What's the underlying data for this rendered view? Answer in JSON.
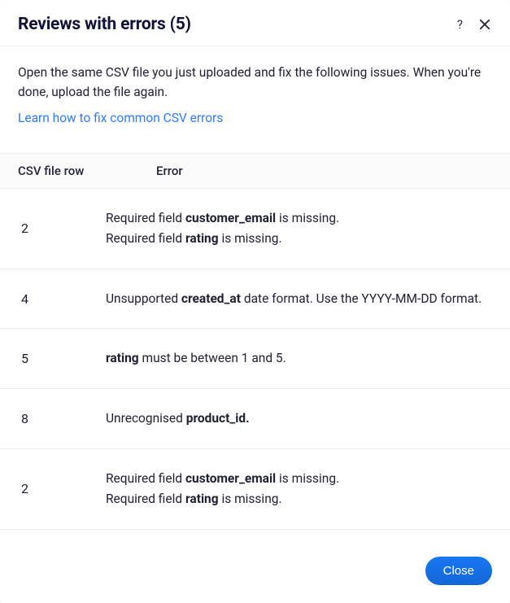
{
  "header": {
    "title": "Reviews with errors (5)"
  },
  "intro": {
    "text": "Open the same CSV file you just uploaded and fix the following issues. When you're done, upload the file again.",
    "link_label": "Learn how to fix common CSV errors"
  },
  "table": {
    "col_row": "CSV file row",
    "col_error": "Error",
    "rows": [
      {
        "row": "2",
        "lines": [
          {
            "pre": "Required field ",
            "bold": "customer_email",
            "post": " is missing."
          },
          {
            "pre": "Required field ",
            "bold": "rating",
            "post": " is missing."
          }
        ]
      },
      {
        "row": "4",
        "lines": [
          {
            "pre": "Unsupported ",
            "bold": "created_at",
            "post": " date format. Use the YYYY-MM-DD format."
          }
        ]
      },
      {
        "row": "5",
        "lines": [
          {
            "pre": "",
            "bold": "rating",
            "post": " must be between 1 and 5."
          }
        ]
      },
      {
        "row": "8",
        "lines": [
          {
            "pre": "Unrecognised ",
            "bold": "product_id.",
            "post": ""
          }
        ]
      },
      {
        "row": "2",
        "lines": [
          {
            "pre": "Required field ",
            "bold": "customer_email",
            "post": " is missing."
          },
          {
            "pre": "Required field ",
            "bold": "rating",
            "post": " is missing."
          }
        ]
      }
    ]
  },
  "footer": {
    "close_label": "Close"
  }
}
